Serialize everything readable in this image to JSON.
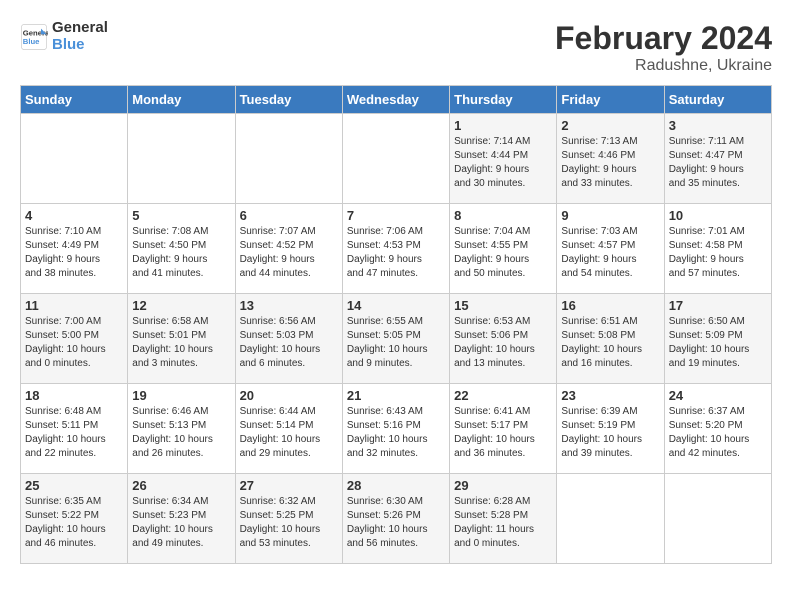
{
  "header": {
    "logo_line1": "General",
    "logo_line2": "Blue",
    "month_year": "February 2024",
    "location": "Radushne, Ukraine"
  },
  "days_of_week": [
    "Sunday",
    "Monday",
    "Tuesday",
    "Wednesday",
    "Thursday",
    "Friday",
    "Saturday"
  ],
  "weeks": [
    [
      {
        "day": "",
        "info": ""
      },
      {
        "day": "",
        "info": ""
      },
      {
        "day": "",
        "info": ""
      },
      {
        "day": "",
        "info": ""
      },
      {
        "day": "1",
        "info": "Sunrise: 7:14 AM\nSunset: 4:44 PM\nDaylight: 9 hours\nand 30 minutes."
      },
      {
        "day": "2",
        "info": "Sunrise: 7:13 AM\nSunset: 4:46 PM\nDaylight: 9 hours\nand 33 minutes."
      },
      {
        "day": "3",
        "info": "Sunrise: 7:11 AM\nSunset: 4:47 PM\nDaylight: 9 hours\nand 35 minutes."
      }
    ],
    [
      {
        "day": "4",
        "info": "Sunrise: 7:10 AM\nSunset: 4:49 PM\nDaylight: 9 hours\nand 38 minutes."
      },
      {
        "day": "5",
        "info": "Sunrise: 7:08 AM\nSunset: 4:50 PM\nDaylight: 9 hours\nand 41 minutes."
      },
      {
        "day": "6",
        "info": "Sunrise: 7:07 AM\nSunset: 4:52 PM\nDaylight: 9 hours\nand 44 minutes."
      },
      {
        "day": "7",
        "info": "Sunrise: 7:06 AM\nSunset: 4:53 PM\nDaylight: 9 hours\nand 47 minutes."
      },
      {
        "day": "8",
        "info": "Sunrise: 7:04 AM\nSunset: 4:55 PM\nDaylight: 9 hours\nand 50 minutes."
      },
      {
        "day": "9",
        "info": "Sunrise: 7:03 AM\nSunset: 4:57 PM\nDaylight: 9 hours\nand 54 minutes."
      },
      {
        "day": "10",
        "info": "Sunrise: 7:01 AM\nSunset: 4:58 PM\nDaylight: 9 hours\nand 57 minutes."
      }
    ],
    [
      {
        "day": "11",
        "info": "Sunrise: 7:00 AM\nSunset: 5:00 PM\nDaylight: 10 hours\nand 0 minutes."
      },
      {
        "day": "12",
        "info": "Sunrise: 6:58 AM\nSunset: 5:01 PM\nDaylight: 10 hours\nand 3 minutes."
      },
      {
        "day": "13",
        "info": "Sunrise: 6:56 AM\nSunset: 5:03 PM\nDaylight: 10 hours\nand 6 minutes."
      },
      {
        "day": "14",
        "info": "Sunrise: 6:55 AM\nSunset: 5:05 PM\nDaylight: 10 hours\nand 9 minutes."
      },
      {
        "day": "15",
        "info": "Sunrise: 6:53 AM\nSunset: 5:06 PM\nDaylight: 10 hours\nand 13 minutes."
      },
      {
        "day": "16",
        "info": "Sunrise: 6:51 AM\nSunset: 5:08 PM\nDaylight: 10 hours\nand 16 minutes."
      },
      {
        "day": "17",
        "info": "Sunrise: 6:50 AM\nSunset: 5:09 PM\nDaylight: 10 hours\nand 19 minutes."
      }
    ],
    [
      {
        "day": "18",
        "info": "Sunrise: 6:48 AM\nSunset: 5:11 PM\nDaylight: 10 hours\nand 22 minutes."
      },
      {
        "day": "19",
        "info": "Sunrise: 6:46 AM\nSunset: 5:13 PM\nDaylight: 10 hours\nand 26 minutes."
      },
      {
        "day": "20",
        "info": "Sunrise: 6:44 AM\nSunset: 5:14 PM\nDaylight: 10 hours\nand 29 minutes."
      },
      {
        "day": "21",
        "info": "Sunrise: 6:43 AM\nSunset: 5:16 PM\nDaylight: 10 hours\nand 32 minutes."
      },
      {
        "day": "22",
        "info": "Sunrise: 6:41 AM\nSunset: 5:17 PM\nDaylight: 10 hours\nand 36 minutes."
      },
      {
        "day": "23",
        "info": "Sunrise: 6:39 AM\nSunset: 5:19 PM\nDaylight: 10 hours\nand 39 minutes."
      },
      {
        "day": "24",
        "info": "Sunrise: 6:37 AM\nSunset: 5:20 PM\nDaylight: 10 hours\nand 42 minutes."
      }
    ],
    [
      {
        "day": "25",
        "info": "Sunrise: 6:35 AM\nSunset: 5:22 PM\nDaylight: 10 hours\nand 46 minutes."
      },
      {
        "day": "26",
        "info": "Sunrise: 6:34 AM\nSunset: 5:23 PM\nDaylight: 10 hours\nand 49 minutes."
      },
      {
        "day": "27",
        "info": "Sunrise: 6:32 AM\nSunset: 5:25 PM\nDaylight: 10 hours\nand 53 minutes."
      },
      {
        "day": "28",
        "info": "Sunrise: 6:30 AM\nSunset: 5:26 PM\nDaylight: 10 hours\nand 56 minutes."
      },
      {
        "day": "29",
        "info": "Sunrise: 6:28 AM\nSunset: 5:28 PM\nDaylight: 11 hours\nand 0 minutes."
      },
      {
        "day": "",
        "info": ""
      },
      {
        "day": "",
        "info": ""
      }
    ]
  ]
}
